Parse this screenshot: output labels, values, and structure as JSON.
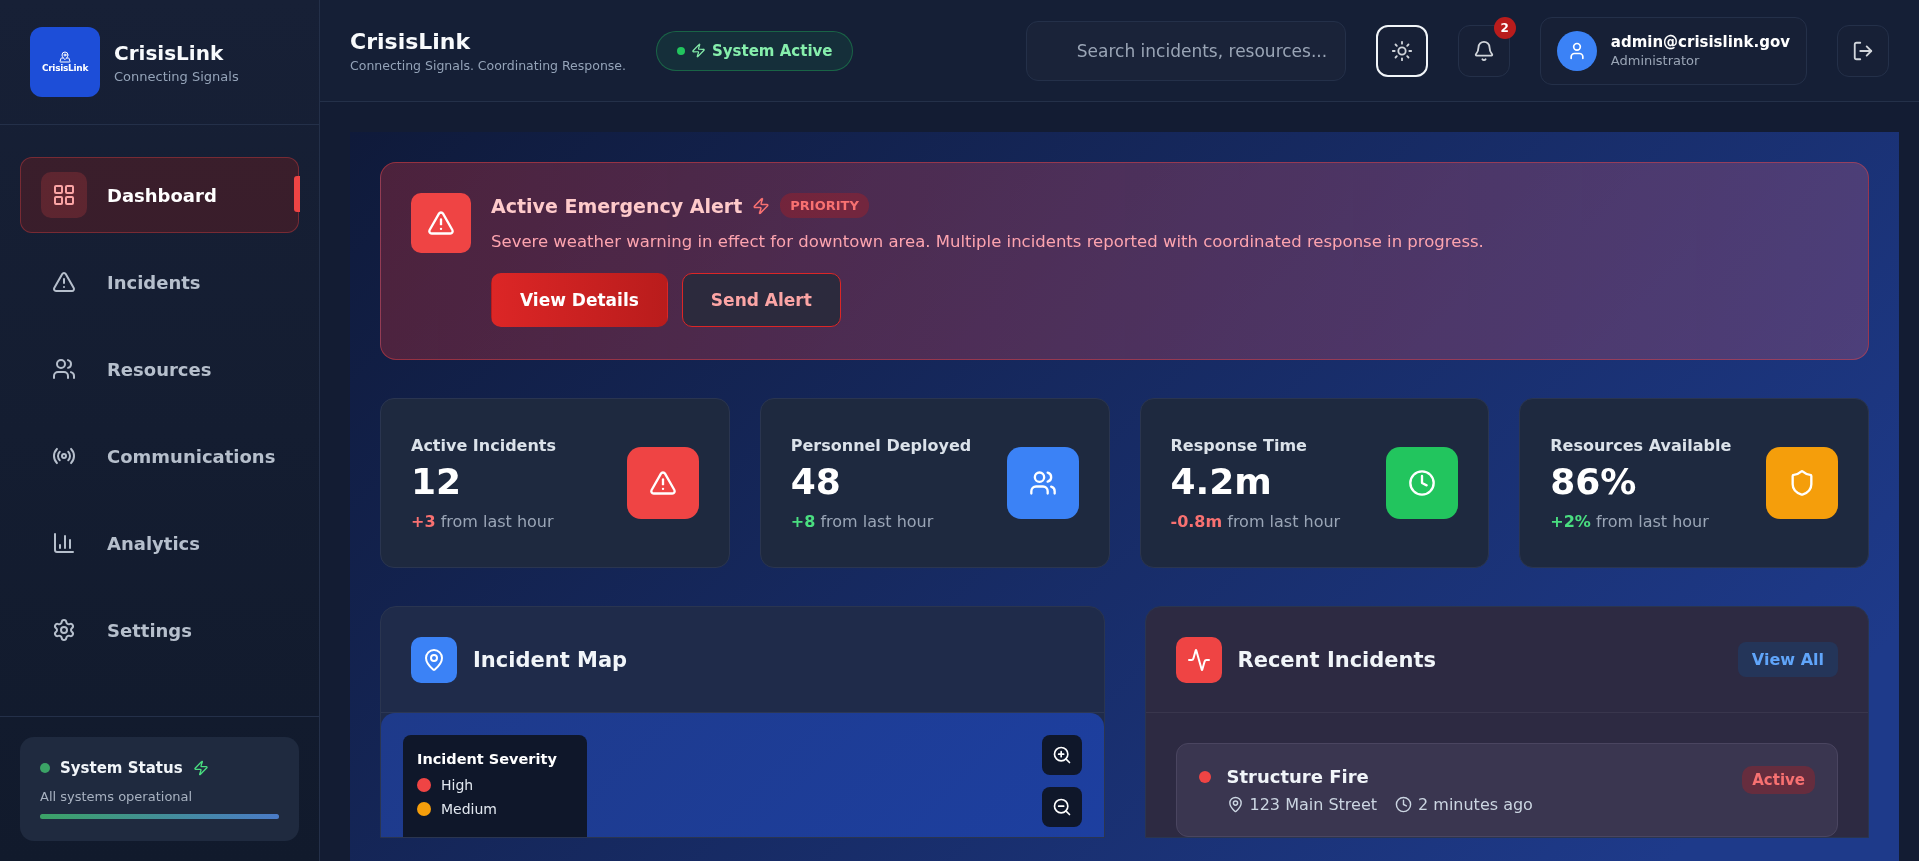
{
  "brand": {
    "logo_text": "CrisisLink",
    "name": "CrisisLink",
    "tagline": "Connecting Signals"
  },
  "sidebar": {
    "items": [
      {
        "label": "Dashboard",
        "selected": true
      },
      {
        "label": "Incidents",
        "selected": false
      },
      {
        "label": "Resources",
        "selected": false
      },
      {
        "label": "Communications",
        "selected": false
      },
      {
        "label": "Analytics",
        "selected": false
      },
      {
        "label": "Settings",
        "selected": false
      }
    ],
    "status": {
      "title": "System Status",
      "text": "All systems operational",
      "level": 1
    }
  },
  "header": {
    "title": "CrisisLink",
    "subtitle": "Connecting Signals. Coordinating Response.",
    "system_badge": "System Active",
    "search": {
      "placeholder": "Search incidents, resources..."
    },
    "notification_count": "2",
    "user": {
      "email": "admin@crisislink.gov",
      "role": "Administrator"
    }
  },
  "alert": {
    "title": "Active Emergency Alert",
    "badge": "PRIORITY",
    "message": "Severe weather warning in effect for downtown area. Multiple incidents reported with coordinated response in progress.",
    "buttons": [
      {
        "label": "View Details",
        "kind": "primary"
      },
      {
        "label": "Send Alert",
        "kind": "secondary"
      }
    ]
  },
  "stats": [
    {
      "label": "Active Incidents",
      "value": "12",
      "delta": "+3",
      "kind": "bad",
      "suffix": "from last hour",
      "color": "#ef4444"
    },
    {
      "label": "Personnel Deployed",
      "value": "48",
      "delta": "+8",
      "kind": "good",
      "suffix": "from last hour",
      "color": "#3b82f6"
    },
    {
      "label": "Response Time",
      "value": "4.2m",
      "delta": "-0.8m",
      "kind": "bad",
      "suffix": "from last hour",
      "color": "#22c55e"
    },
    {
      "label": "Resources Available",
      "value": "86%",
      "delta": "+2%",
      "kind": "good",
      "suffix": "from last hour",
      "color": "#f59e0b"
    }
  ],
  "map": {
    "title": "Incident Map",
    "legend": {
      "title": "Incident Severity",
      "items": [
        {
          "label": "High",
          "color": "#ef4444"
        },
        {
          "label": "Medium",
          "color": "#f59e0b"
        }
      ]
    }
  },
  "recent": {
    "title": "Recent Incidents",
    "view_all": "View All",
    "items": [
      {
        "title": "Structure Fire",
        "location": "123 Main Street",
        "time": "2 minutes ago",
        "status": "Active",
        "color": "#ef4444"
      }
    ]
  }
}
